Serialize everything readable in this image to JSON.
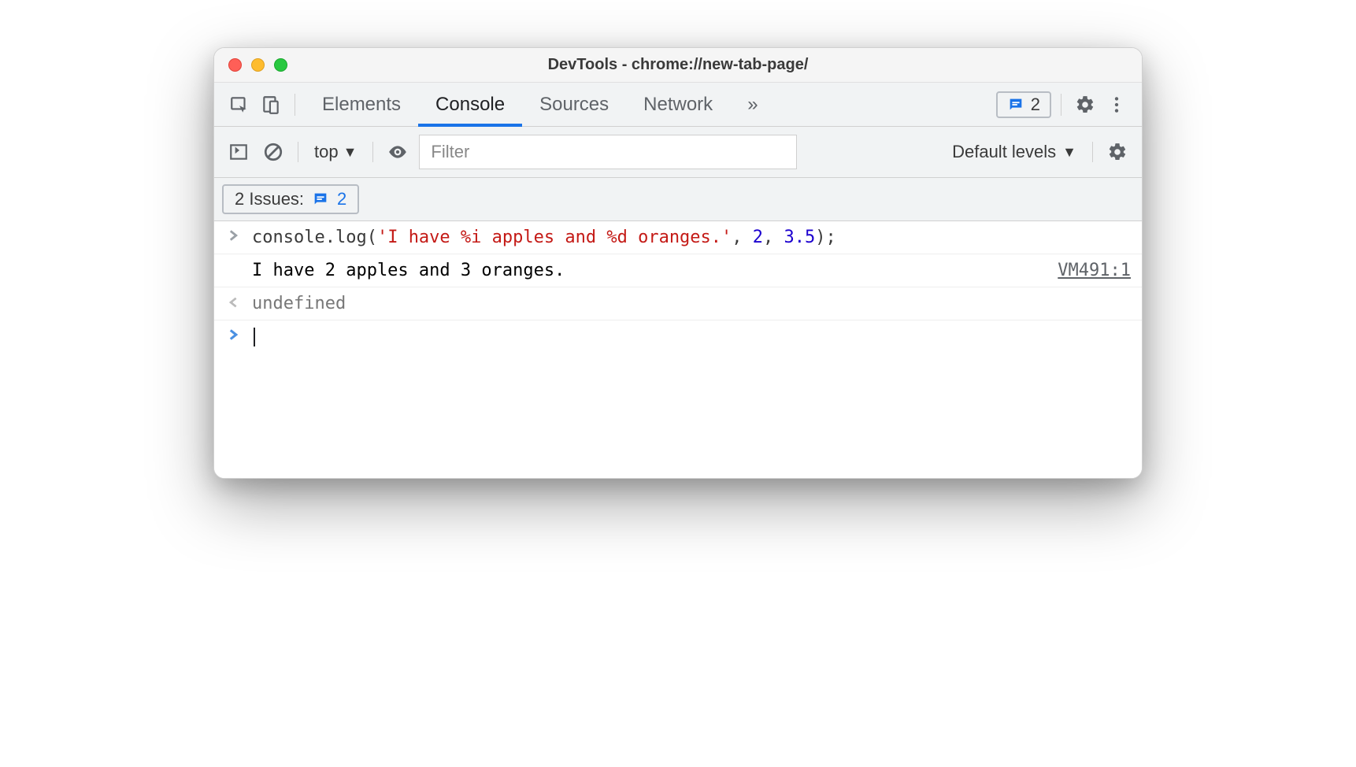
{
  "window": {
    "title": "DevTools - chrome://new-tab-page/"
  },
  "tabs": {
    "elements": "Elements",
    "console": "Console",
    "sources": "Sources",
    "network": "Network",
    "more": "»",
    "badge_count": "2"
  },
  "toolbar": {
    "context": "top",
    "filter_placeholder": "Filter",
    "levels": "Default levels"
  },
  "issues": {
    "label": "2 Issues:",
    "count": "2"
  },
  "console": {
    "input_prefix": "console.log(",
    "input_string": "'I have %i apples and %d oranges.'",
    "input_sep1": ", ",
    "input_arg1": "2",
    "input_sep2": ", ",
    "input_arg2": "3.5",
    "input_suffix": ");",
    "output": "I have 2 apples and 3 oranges.",
    "source_link": "VM491:1",
    "return_value": "undefined"
  }
}
